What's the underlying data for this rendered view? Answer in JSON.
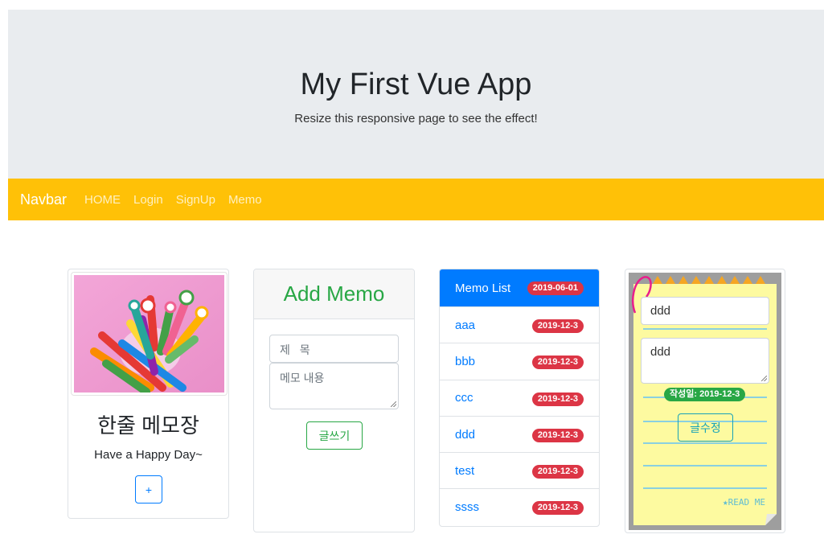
{
  "header": {
    "title": "My First Vue App",
    "subtitle": "Resize this responsive page to see the effect!"
  },
  "navbar": {
    "brand": "Navbar",
    "links": [
      "HOME",
      "Login",
      "SignUp",
      "Memo"
    ]
  },
  "profile_card": {
    "title": "한줄 메모장",
    "subtitle": "Have a Happy Day~",
    "button_label": "+"
  },
  "add_memo": {
    "header": "Add Memo",
    "title_placeholder": "제 목",
    "content_placeholder": "메모 내용",
    "submit_label": "글쓰기"
  },
  "memo_list": {
    "header": "Memo List",
    "header_badge": "2019-06-01",
    "items": [
      {
        "title": "aaa",
        "date": "2019-12-3"
      },
      {
        "title": "bbb",
        "date": "2019-12-3"
      },
      {
        "title": "ccc",
        "date": "2019-12-3"
      },
      {
        "title": "ddd",
        "date": "2019-12-3"
      },
      {
        "title": "test",
        "date": "2019-12-3"
      },
      {
        "title": "ssss",
        "date": "2019-12-3"
      }
    ]
  },
  "memo_detail": {
    "title_value": "ddd",
    "content_value": "ddd",
    "date_badge": "작성일: 2019-12-3",
    "edit_label": "글수정",
    "note_text": "★READ ME"
  },
  "colors": {
    "navbar": "#ffc107",
    "primary": "#007bff",
    "success": "#28a745",
    "danger": "#dc3545",
    "info": "#17a2b8"
  }
}
